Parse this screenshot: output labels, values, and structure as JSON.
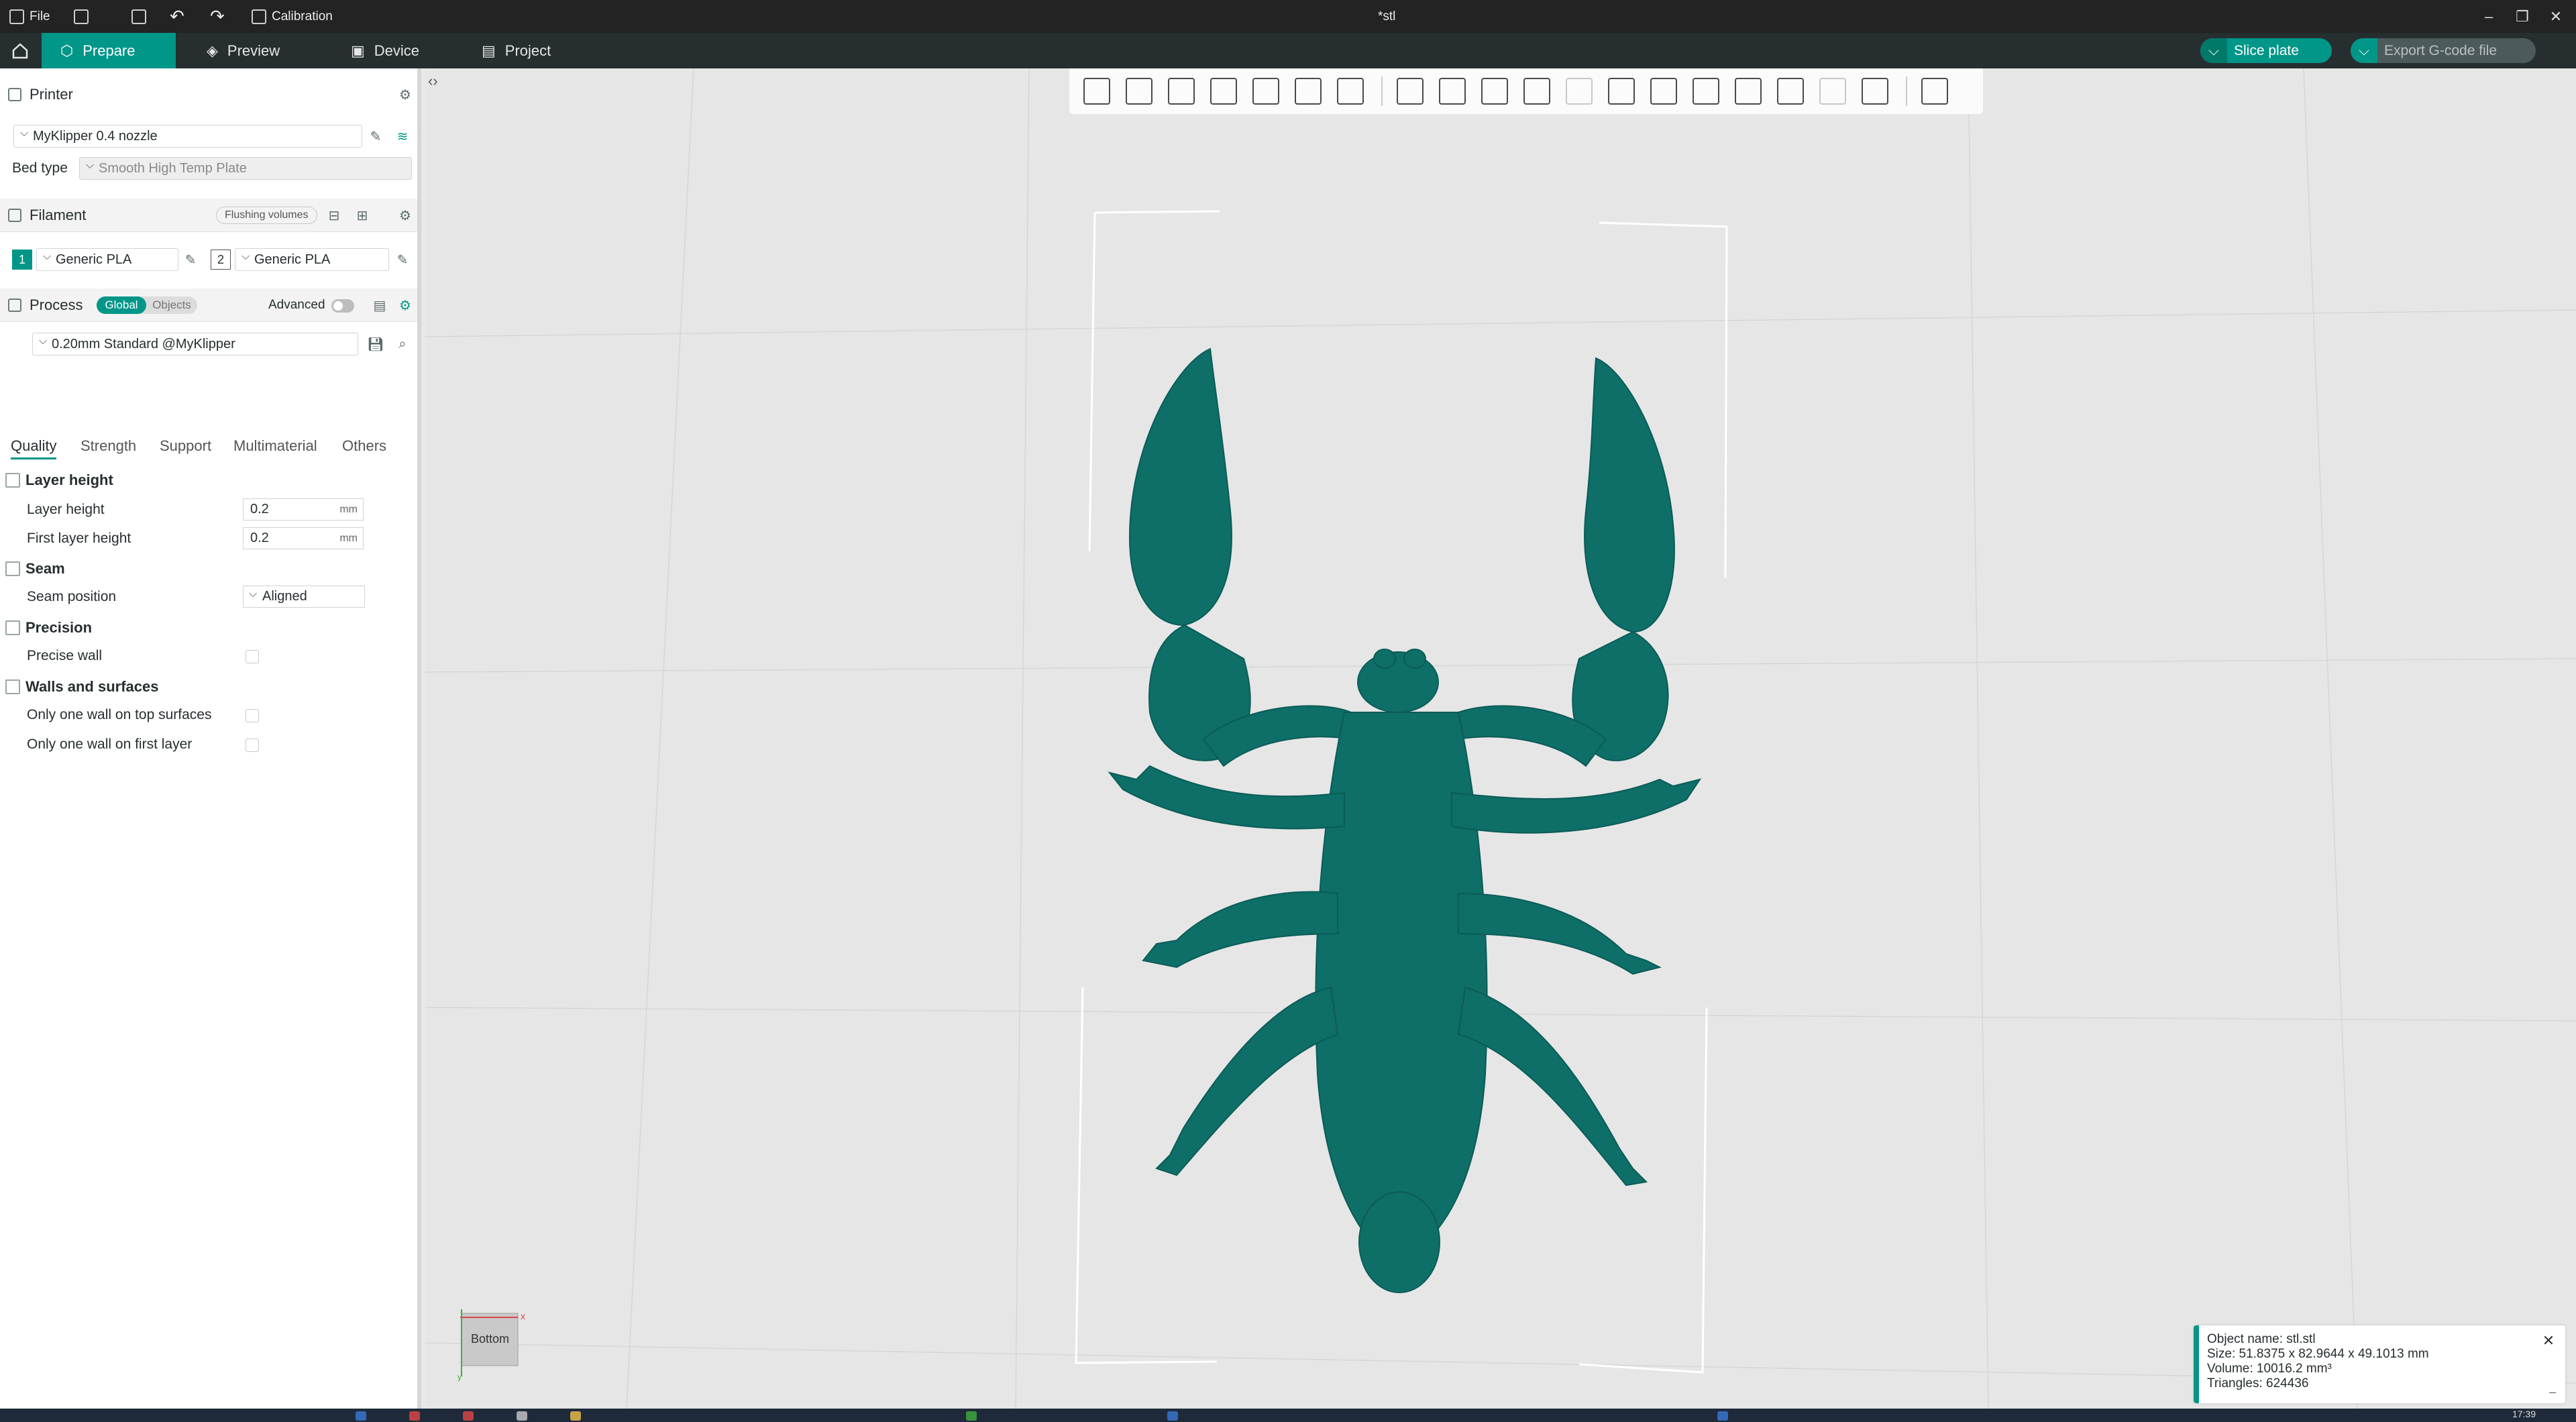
{
  "titlebar": {
    "file_label": "File",
    "calibration_label": "Calibration",
    "doc_title": "*stl"
  },
  "mainbar": {
    "tabs": [
      {
        "label": "Prepare"
      },
      {
        "label": "Preview"
      },
      {
        "label": "Device"
      },
      {
        "label": "Project"
      }
    ],
    "slice_label": "Slice plate",
    "export_label": "Export G-code file"
  },
  "printer": {
    "title": "Printer",
    "preset": "MyKlipper 0.4 nozzle",
    "bed_type_label": "Bed type",
    "bed_type_value": "Smooth High Temp Plate"
  },
  "filament": {
    "title": "Filament",
    "flushing_label": "Flushing volumes",
    "slots": [
      {
        "index": "1",
        "name": "Generic PLA",
        "color": "#009688"
      },
      {
        "index": "2",
        "name": "Generic PLA",
        "color": "#ffffff"
      }
    ]
  },
  "process": {
    "title": "Process",
    "global_label": "Global",
    "objects_label": "Objects",
    "advanced_label": "Advanced",
    "preset": "0.20mm Standard @MyKlipper",
    "tabs": [
      "Quality",
      "Strength",
      "Support",
      "Multimaterial",
      "Others"
    ]
  },
  "quality": {
    "layer_height_group": "Layer height",
    "layer_height_label": "Layer height",
    "layer_height_value": "0.2",
    "first_layer_height_label": "First layer height",
    "first_layer_height_value": "0.2",
    "unit": "mm",
    "seam_group": "Seam",
    "seam_position_label": "Seam position",
    "seam_position_value": "Aligned",
    "precision_group": "Precision",
    "precise_wall_label": "Precise wall",
    "walls_group": "Walls and surfaces",
    "one_wall_top_label": "Only one wall on top surfaces",
    "one_wall_first_label": "Only one wall on first layer"
  },
  "viewport": {
    "model_color": "#0e6e68",
    "view_label": "Bottom",
    "axis_x": "x",
    "axis_y": "y"
  },
  "object_info": {
    "name": "Object name: stl.stl",
    "size": "Size: 51.8375 x 82.9644 x 49.1013 mm",
    "volume": "Volume: 10016.2 mm³",
    "triangles": "Triangles: 624436"
  },
  "taskbar": {
    "clock": "17:39"
  },
  "colors": {
    "accent": "#009688",
    "topbar": "#262e30",
    "titlebar": "#232323"
  }
}
